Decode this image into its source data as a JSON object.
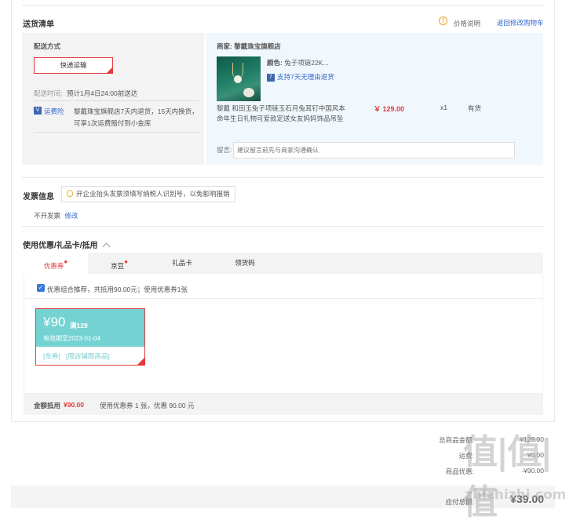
{
  "section_title": "送货清单",
  "price_note": "价格说明",
  "back_to_cart": "返回修改购物车",
  "shipping": {
    "heading": "配送方式",
    "method_button": "快递运输",
    "time_label": "配送时间:",
    "time_value": "预计1月4日24:00前送达",
    "insurance_link": "运费险",
    "insurance_desc_1": "黎戴珠宝旗舰店7天内退货，15天内换货，",
    "insurance_desc_2": "可享1次运费赔付到小金库"
  },
  "store": {
    "label": "商家:",
    "name": "黎戴珠宝旗舰店",
    "color_label": "颜色:",
    "color_value": "兔子项链22K...",
    "return_badge": "支持7天无理由退货",
    "product_name_1": "黎戴 和田玉兔子项链玉石月兔耳钉中国风本",
    "product_name_2": "命年生日礼物可爱款定送女友妈妈饰品吊坠",
    "price": "￥ 129.00",
    "qty": "x1",
    "stock": "有货",
    "message_label": "留言:",
    "message_placeholder": "建议留言前先与商家沟通确认"
  },
  "invoice": {
    "title": "发票信息",
    "tip": "开企业抬头发票须填写纳税人识别号，以免影响报销",
    "status": "不开发票",
    "edit": "修改"
  },
  "discount": {
    "title": "使用优惠/礼品卡/抵用",
    "tabs": [
      {
        "label": "优惠券",
        "dot": "●"
      },
      {
        "label": "京豆",
        "dot": "●"
      },
      {
        "label": "礼品卡",
        "dot": ""
      },
      {
        "label": "领货码",
        "dot": ""
      }
    ],
    "recommend_text": "优惠组合推荐，共抵用90.00元；使用优惠券1张",
    "coupon": {
      "amount": "¥90",
      "condition": "满129",
      "expiry": "有效期至2023-01-04",
      "tag1": "[东券]",
      "tag2": "[限店铺限商品]"
    },
    "total_label": "金额抵用",
    "total_amount": "¥90.00",
    "total_desc": "使用优惠券 1 张，优惠 90.00 元"
  },
  "summary": {
    "goods_label": "总商品金额:",
    "goods_value": "¥129.00",
    "freight_label": "运费:",
    "freight_value": "¥0.00",
    "coupon_label": "商品优惠:",
    "coupon_value": "-¥90.00",
    "pay_label": "应付总额:",
    "pay_value": "¥39.00"
  },
  "watermark": {
    "main": "值|值|值",
    "url": "zhizhizhi.com"
  },
  "colors": {
    "accent_red": "#e4393c",
    "link_blue": "#3366cc",
    "coupon_teal": "#74d2d2"
  }
}
